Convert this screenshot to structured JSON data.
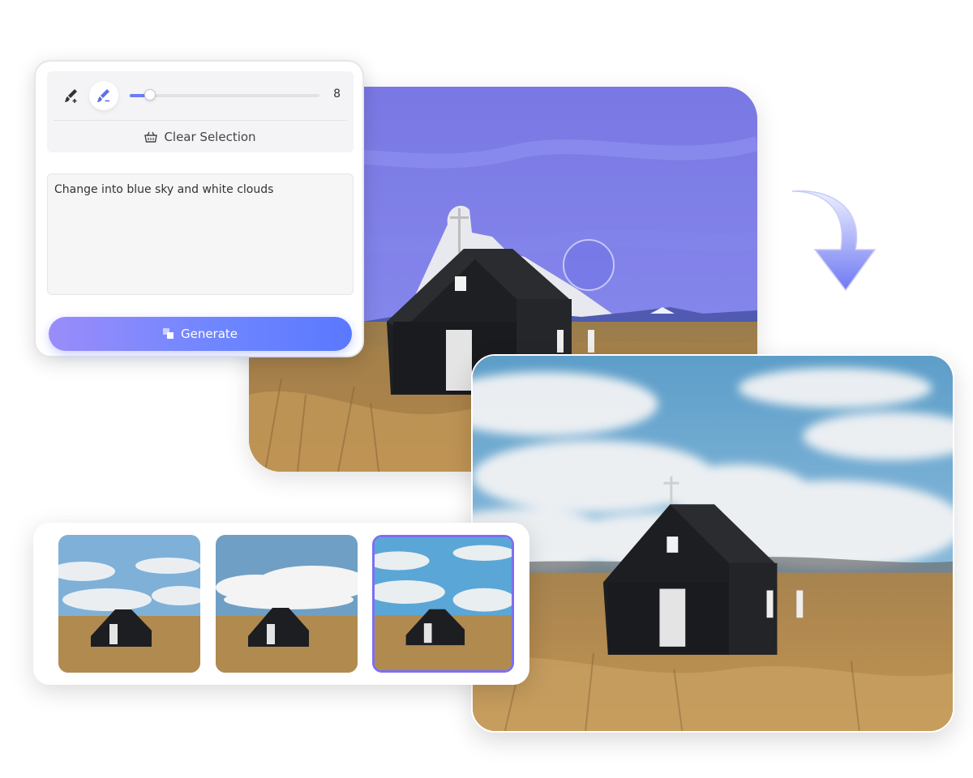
{
  "brush": {
    "size_value": "8",
    "size_fraction": 0.08,
    "clear_label": "Clear Selection"
  },
  "prompt": {
    "value": "Change into blue sky and white clouds"
  },
  "generate_label": "Generate",
  "thumbnails": {
    "selected_index": 2,
    "count": 3
  },
  "colors": {
    "accent": "#6b7cf6",
    "selection_overlay": "#7b7ff0",
    "thumb_selected_border": "#7c6ff2"
  },
  "icons": {
    "brush_add": "brush-add-icon",
    "brush_erase": "brush-erase-icon",
    "clear": "basket-icon",
    "generate": "generate-icon",
    "arrow": "curved-arrow-icon"
  }
}
